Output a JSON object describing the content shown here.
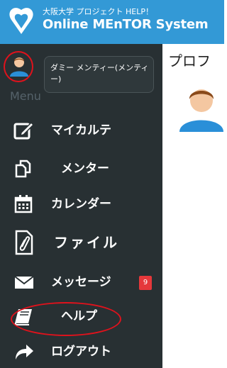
{
  "header": {
    "subtitle": "大阪大学 プロジェクト HELP！",
    "title": "Online MEnTOR System"
  },
  "user": {
    "name": "ダミー メンティー(メンティー)"
  },
  "sidebar": {
    "caption": "Menu",
    "items": [
      {
        "label": "マイカルテ",
        "icon": "edit-square-icon"
      },
      {
        "label": "メンター",
        "icon": "copy-icon"
      },
      {
        "label": "カレンダー",
        "icon": "calendar-icon"
      },
      {
        "label": "ファイル",
        "icon": "attachment-file-icon"
      },
      {
        "label": "メッセージ",
        "icon": "envelope-icon",
        "badge": "9"
      },
      {
        "label": "ヘルプ",
        "icon": "book-icon"
      },
      {
        "label": "ログアウト",
        "icon": "share-arrow-icon"
      }
    ]
  },
  "main": {
    "title": "プロフ"
  },
  "colors": {
    "header_bg": "#3399d6",
    "sidebar_bg": "#283033",
    "badge_bg": "#e5383b",
    "highlight_ring": "#e0121c"
  }
}
